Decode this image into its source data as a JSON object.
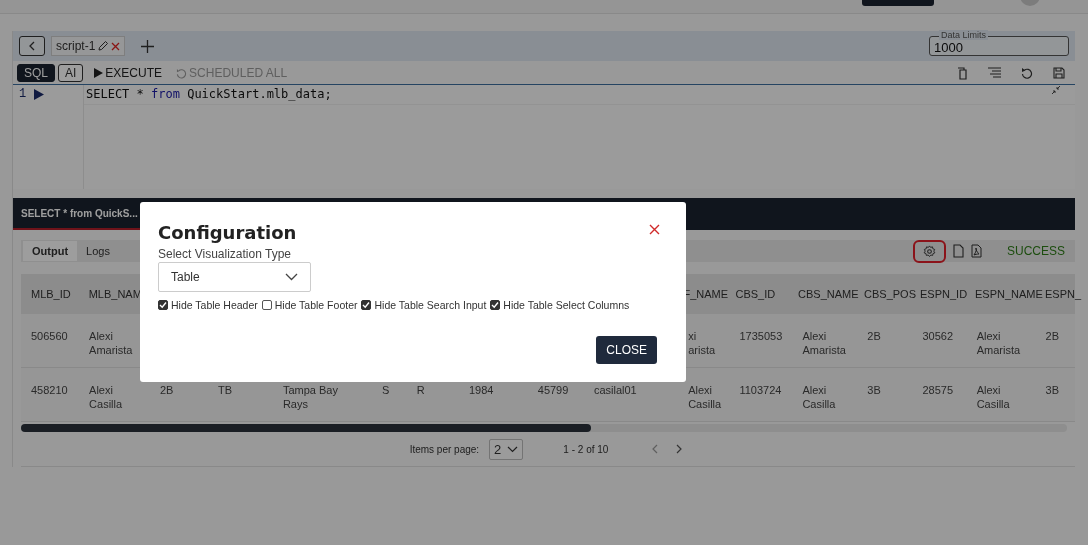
{
  "script_tabs": [
    {
      "label": "script-1",
      "selected": true
    }
  ],
  "data_limits": {
    "label": "Data Limits",
    "value": "1000"
  },
  "modes": [
    {
      "label": "SQL",
      "selected": true
    },
    {
      "label": "AI",
      "selected": false
    }
  ],
  "actions": [
    {
      "label": "EXECUTE",
      "kind": "play",
      "disabled": false
    },
    {
      "label": "SCHEDULED ALL",
      "kind": "refresh",
      "disabled": true
    }
  ],
  "editor": {
    "line_number": "1",
    "code": [
      {
        "text": "SELECT * ",
        "kind": "plain"
      },
      {
        "text": "from",
        "kind": "keyword"
      },
      {
        "text": " QuickStart.mlb_data;",
        "kind": "plain"
      }
    ]
  },
  "result_tab": {
    "label": "SELECT * from QuickS..."
  },
  "output_tabs": [
    {
      "label": "Output",
      "selected": true
    },
    {
      "label": "Logs",
      "selected": false
    }
  ],
  "status": "SUCCESS",
  "table": {
    "columns": [
      "MLB_ID",
      "MLB_NAM",
      null,
      null,
      null,
      null,
      null,
      null,
      null,
      null,
      "F_NAME",
      "CBS_ID",
      "CBS_NAME",
      "CBS_POS",
      "ESPN_ID",
      "ESPN_NAME",
      "ESPN_"
    ],
    "rows": [
      [
        "506560",
        "Alexi Amarista",
        null,
        null,
        null,
        null,
        null,
        null,
        null,
        null,
        "xi arista",
        "1735053",
        "Alexi Amarista",
        "2B",
        "30562",
        "Alexi Amarista",
        "2B"
      ],
      [
        "458210",
        "Alexi Casilla",
        "2B",
        "TB",
        "Tampa Bay Rays",
        "S",
        "R",
        "1984",
        "45799",
        "casilal01",
        "Alexi Casilla",
        "1103724",
        "Alexi Casilla",
        "3B",
        "28575",
        "Alexi Casilla",
        "3B"
      ]
    ]
  },
  "pagination": {
    "label": "Items per page:",
    "page_size": "2",
    "range": "1 - 2 of 10"
  },
  "modal": {
    "title": "Configuration",
    "field_label": "Select Visualization Type",
    "value": "Table",
    "options": [
      {
        "label": "Hide Table Header",
        "checked": true
      },
      {
        "label": "Hide Table Footer",
        "checked": false
      },
      {
        "label": "Hide Table Search Input",
        "checked": true
      },
      {
        "label": "Hide Table Select Columns",
        "checked": true
      }
    ],
    "button": "CLOSE"
  }
}
